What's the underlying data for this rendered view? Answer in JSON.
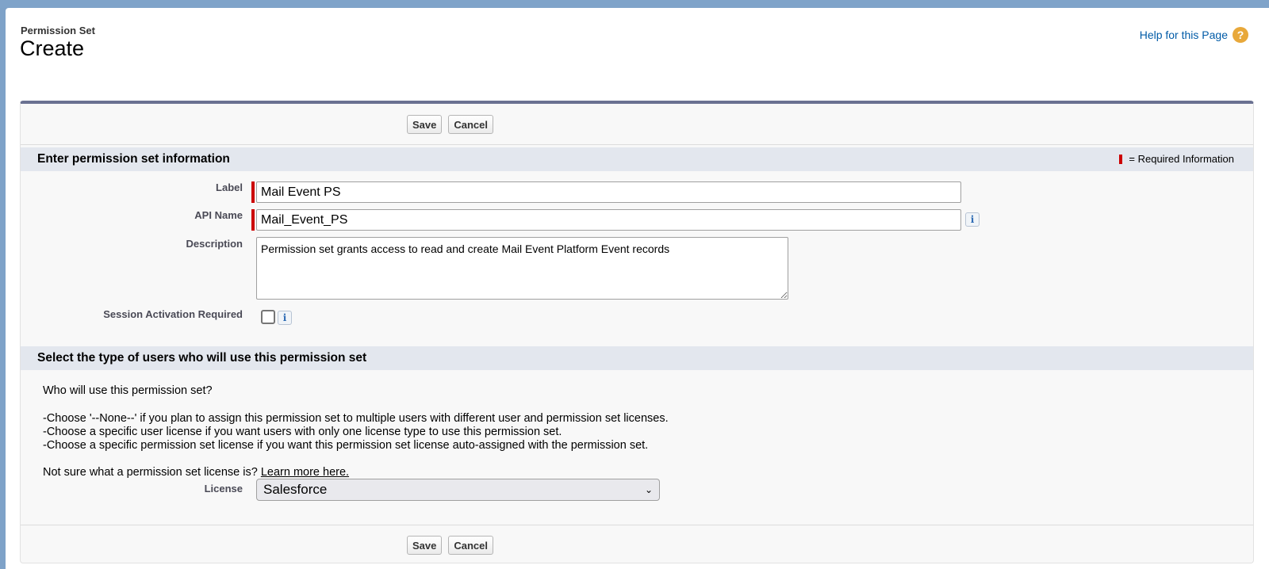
{
  "header": {
    "breadcrumb": "Permission Set",
    "title": "Create",
    "help_label": "Help for this Page",
    "help_icon": "?"
  },
  "buttons": {
    "save": "Save",
    "cancel": "Cancel"
  },
  "section1": {
    "title": "Enter permission set information",
    "required_legend": "= Required Information"
  },
  "fields": {
    "label": {
      "label": "Label",
      "value": "Mail Event PS"
    },
    "api_name": {
      "label": "API Name",
      "value": "Mail_Event_PS"
    },
    "description": {
      "label": "Description",
      "value": "Permission set grants access to read and create Mail Event Platform Event records"
    },
    "session": {
      "label": "Session Activation Required",
      "checked": false
    }
  },
  "section2": {
    "title": "Select the type of users who will use this permission set",
    "question": "Who will use this permission set?",
    "line1": "-Choose '--None--' if you plan to assign this permission set to multiple users with different user and permission set licenses.",
    "line2": "-Choose a specific user license if you want users with only one license type to use this permission set.",
    "line3": "-Choose a specific permission set license if you want this permission set license auto-assigned with the permission set.",
    "not_sure": "Not sure what a permission set license is?",
    "learn_more": "Learn more here.",
    "license_label": "License",
    "license_value": "Salesforce"
  },
  "info_icon_glyph": "i",
  "colors": {
    "required": "#cc0000",
    "link": "#015ba7",
    "panel_top": "#6a7191"
  }
}
